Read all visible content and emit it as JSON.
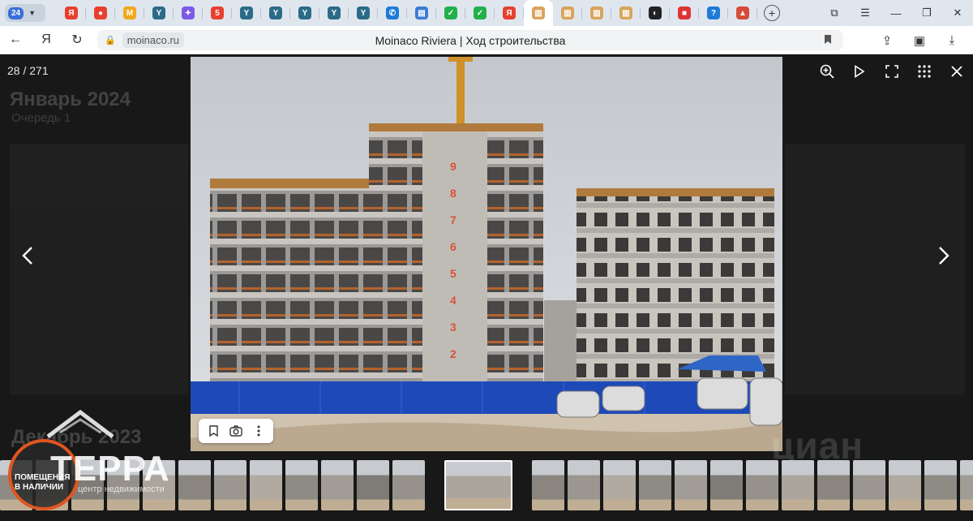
{
  "tabs": {
    "counter": "24",
    "favicons": [
      {
        "name": "yandex",
        "color": "#e8402f",
        "glyph": "Я"
      },
      {
        "name": "maps-pin",
        "color": "#e8402f",
        "glyph": "●"
      },
      {
        "name": "mail",
        "color": "#f2a81d",
        "glyph": "M"
      },
      {
        "name": "y-tab",
        "color": "#2b6b87",
        "glyph": "Y"
      },
      {
        "name": "apps",
        "color": "#7b5be6",
        "glyph": "✦"
      },
      {
        "name": "five",
        "color": "#e8402f",
        "glyph": "5"
      },
      {
        "name": "y-tab",
        "color": "#2b6b87",
        "glyph": "Y"
      },
      {
        "name": "y-tab",
        "color": "#2b6b87",
        "glyph": "Y"
      },
      {
        "name": "y-tab",
        "color": "#2b6b87",
        "glyph": "Y"
      },
      {
        "name": "y-tab",
        "color": "#2b6b87",
        "glyph": "Y"
      },
      {
        "name": "y-tab",
        "color": "#2b6b87",
        "glyph": "Y"
      },
      {
        "name": "phone",
        "color": "#1d7bd8",
        "glyph": "✆"
      },
      {
        "name": "doc",
        "color": "#3b7bd6",
        "glyph": "▤"
      },
      {
        "name": "check",
        "color": "#22b04b",
        "glyph": "✓"
      },
      {
        "name": "check",
        "color": "#22b04b",
        "glyph": "✓"
      },
      {
        "name": "yandex",
        "color": "#e8402f",
        "glyph": "Я"
      },
      {
        "name": "moinaco",
        "color": "#d9a45a",
        "glyph": "▥",
        "active": true
      },
      {
        "name": "moinaco",
        "color": "#d9a45a",
        "glyph": "▥"
      },
      {
        "name": "moinaco",
        "color": "#d9a45a",
        "glyph": "▥"
      },
      {
        "name": "moinaco",
        "color": "#d9a45a",
        "glyph": "▥"
      },
      {
        "name": "mask",
        "color": "#222222",
        "glyph": "◐"
      },
      {
        "name": "flag",
        "color": "#d33",
        "glyph": "■"
      },
      {
        "name": "help",
        "color": "#1d7bd8",
        "glyph": "?"
      },
      {
        "name": "ext",
        "color": "#d64b3a",
        "glyph": "▲"
      }
    ]
  },
  "address": {
    "domain": "moinaco.ru",
    "title": "Moinaco Riviera | Ход строительства"
  },
  "viewer": {
    "counter": "28 / 271",
    "bg_heading": "Январь 2024",
    "bg_sub": "Очередь 1",
    "bg_heading2": "Декабрь 2023",
    "watermark": "циан",
    "logo_brand": "ТЕРРА",
    "logo_sub": "центр недвижимости",
    "logo_badge": "ПОМЕЩЕНИЯ\nВ НАЛИЧИИ",
    "floor_marks": [
      "9",
      "8",
      "7",
      "6",
      "5",
      "4",
      "3",
      "2"
    ]
  },
  "colors": {
    "accent": "#3a6fd8",
    "fence": "#1e49b8",
    "logo_orange": "#e0561f"
  }
}
